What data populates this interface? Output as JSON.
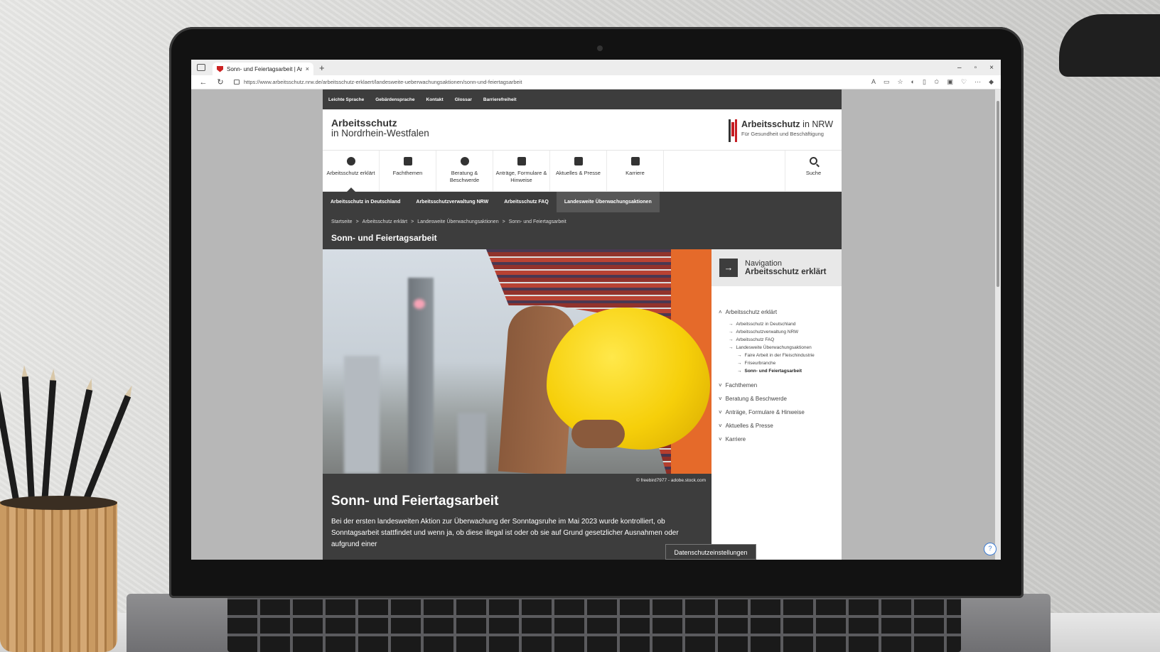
{
  "browser": {
    "tab_title": "Sonn- und Feiertagsarbeit | Arbei",
    "close_symbol": "×",
    "new_tab_symbol": "+",
    "url": "https://www.arbeitsschutz.nrw.de/arbeitsschutz-erklaert/landesweite-ueberwachungsaktionen/sonn-und-feiertagsarbeit",
    "window_controls": [
      "–",
      "▫",
      "×"
    ]
  },
  "service_bar": [
    "Leichte Sprache",
    "Gebärdensprache",
    "Kontakt",
    "Glossar",
    "Barrierefreiheit"
  ],
  "brand": {
    "line1": "Arbeitsschutz",
    "line2": "in Nordrhein-Westfalen",
    "logo_bold": "Arbeitsschutz",
    "logo_rest": " in NRW",
    "logo_sub": "Für Gesundheit und Beschäftigung"
  },
  "main_nav": [
    {
      "label": "Arbeitsschutz erklärt",
      "icon": "question-icon"
    },
    {
      "label": "Fachthemen",
      "icon": "building-icon"
    },
    {
      "label": "Beratung & Beschwerde",
      "icon": "chat-icon"
    },
    {
      "label": "Anträge, Formulare & Hinweise",
      "icon": "list-icon"
    },
    {
      "label": "Aktuelles & Presse",
      "icon": "newspaper-icon"
    },
    {
      "label": "Karriere",
      "icon": "briefcase-icon"
    }
  ],
  "search_label": "Suche",
  "sub_nav": [
    "Arbeitsschutz in Deutschland",
    "Arbeitsschutzverwaltung NRW",
    "Arbeitsschutz FAQ",
    "Landesweite Überwachungsaktionen"
  ],
  "breadcrumb": [
    "Startseite",
    "Arbeitsschutz erklärt",
    "Landesweite Überwachungsaktionen",
    "Sonn- und Feiertagsarbeit"
  ],
  "breadcrumb_sep": ">",
  "page_title": "Sonn- und Feiertagsarbeit",
  "image_credit": "© freebird7977 - adobe.stock.com",
  "article": {
    "heading": "Sonn- und Feiertagsarbeit",
    "text": "Bei der ersten landesweiten Aktion zur Überwachung der Sonntagsruhe im Mai 2023 wurde kontrolliert, ob Sonntagsarbeit stattfindet und wenn ja, ob diese illegal ist oder ob sie auf Grund gesetzlicher Ausnahmen oder aufgrund einer"
  },
  "side_nav": {
    "title1": "Navigation",
    "title2": "Arbeitsschutz erklärt",
    "arrow": "→",
    "top": "Arbeitsschutz erklärt",
    "items": [
      "Arbeitsschutz in Deutschland",
      "Arbeitsschutzverwaltung NRW",
      "Arbeitsschutz FAQ",
      "Landesweite Überwachungsaktionen"
    ],
    "subitems": [
      "Faire Arbeit in der Fleischindustrie",
      "Friseurbranche",
      "Sonn- und Feiertagsarbeit"
    ],
    "collapsed": [
      "Fachthemen",
      "Beratung & Beschwerde",
      "Anträge, Formulare & Hinweise",
      "Aktuelles & Presse",
      "Karriere"
    ]
  },
  "cookie_button": "Datenschutzeinstellungen"
}
